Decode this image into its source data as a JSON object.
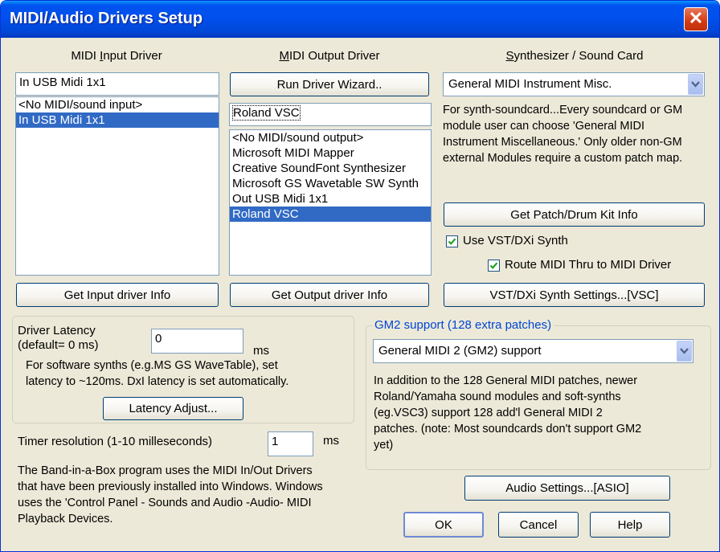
{
  "window": {
    "title": "MIDI/Audio Drivers Setup",
    "close_symbol": "✕"
  },
  "input": {
    "heading_pre": "MIDI ",
    "heading_key": "I",
    "heading_post": "nput Driver",
    "value": "In USB Midi 1x1",
    "items": [
      "<No MIDI/sound input>",
      "In USB Midi 1x1"
    ],
    "selected_index": 1,
    "info_button": "Get Input driver Info"
  },
  "output": {
    "heading_key": "M",
    "heading_post": "IDI Output Driver",
    "wizard_button": "Run Driver Wizard..",
    "value": "Roland VSC",
    "items": [
      "<No MIDI/sound output>",
      "Microsoft MIDI Mapper",
      "Creative SoundFont Synthesizer",
      "Microsoft GS Wavetable SW Synth",
      "Out USB Midi 1x1",
      "Roland VSC"
    ],
    "selected_index": 5,
    "info_button": "Get Output driver Info"
  },
  "synth": {
    "heading_key": "S",
    "heading_post": "ynthesizer / Sound Card",
    "select_value": "General MIDI Instrument Misc.",
    "description_lines": [
      "For synth-soundcard...Every soundcard or GM",
      "module user can choose 'General MIDI",
      "Instrument Miscellaneous.' Only older non-GM",
      "external Modules require a custom patch map."
    ],
    "patch_button": "Get Patch/Drum Kit Info",
    "vst_checkbox": "Use VST/DXi Synth",
    "route_checkbox": "Route MIDI Thru to MIDI Driver",
    "settings_button": "VST/DXi Synth Settings...[VSC]"
  },
  "latency": {
    "label_line1": "Driver Latency",
    "label_line2": "(default= 0 ms)",
    "value": "0",
    "unit": "ms",
    "note_line1": "For software synths  (e.g.MS GS WaveTable), set",
    "note_line2": "latency to ~120ms. DxI latency is set automatically.",
    "adjust_button": "Latency Adjust..."
  },
  "timer": {
    "label": "Timer resolution (1-10 milleseconds)",
    "value": "1",
    "unit": "ms"
  },
  "info_lines": [
    "The Band-in-a-Box program uses the MIDI In/Out Drivers",
    "that have been previously installed into Windows. Windows",
    "uses the 'Control Panel - Sounds and Audio -Audio- MIDI",
    "Playback Devices."
  ],
  "gm2": {
    "legend": "GM2 support (128 extra patches)",
    "select_value": "General MIDI 2 (GM2) support",
    "description_lines": [
      "In addition to the 128 General MIDI patches, newer",
      "Roland/Yamaha sound modules and soft-synths",
      "(eg.VSC3) support 128 add'l General MIDI 2",
      "patches. (note: Most soundcards don't support GM2",
      "yet)"
    ]
  },
  "buttons": {
    "audio_settings": "Audio Settings...[ASIO]",
    "ok": "OK",
    "cancel": "Cancel",
    "help": "Help"
  },
  "colors": {
    "title_blue": "#0050ee",
    "dialog_bg": "#ece9d8",
    "selection": "#316ac5",
    "legend_blue": "#0046d5",
    "close_red": "#d23a12"
  }
}
